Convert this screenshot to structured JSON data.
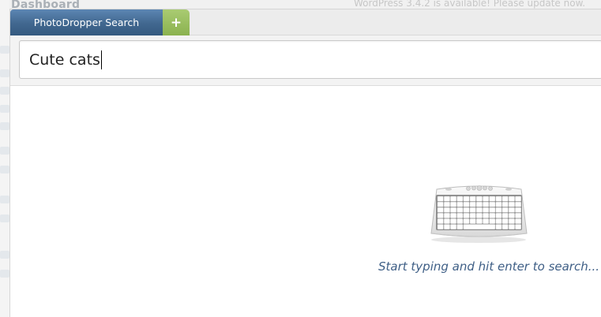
{
  "background": {
    "page_title": "Dashboard",
    "update_notice": "WordPress 3.4.2 is available! Please update now."
  },
  "tabs": [
    {
      "label": "PhotoDropper Search",
      "active": true
    }
  ],
  "add_tab": {
    "label": "+"
  },
  "search": {
    "value": "Cute cats"
  },
  "empty_state": {
    "icon": "keyboard-icon",
    "hint": "Start typing and hit enter to search..."
  },
  "colors": {
    "tab_active": "#41678f",
    "add_tab": "#8bb24f",
    "hint_text": "#3f5f86"
  }
}
